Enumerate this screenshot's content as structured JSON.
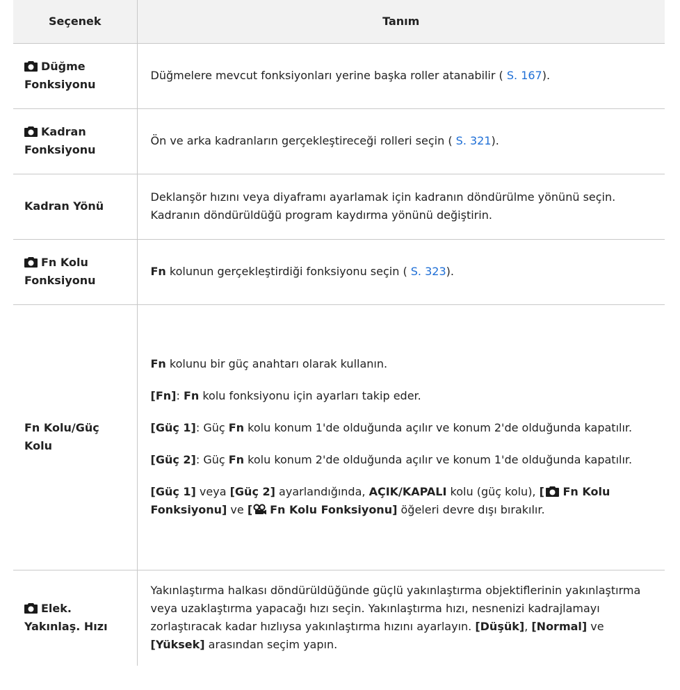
{
  "header": {
    "col1": "Seçenek",
    "col2": "Tanım"
  },
  "rows": {
    "r1": {
      "opt_line1": "Düğme",
      "opt_line2": "Fonksiyonu",
      "desc_pre": "Düğmelere mevcut fonksiyonları yerine başka roller atanabilir ( ",
      "desc_link": "S. 167",
      "desc_post": ")."
    },
    "r2": {
      "opt_line1": "Kadran",
      "opt_line2": "Fonksiyonu",
      "desc_pre": "Ön ve arka kadranların gerçekleştireceği rolleri seçin ( ",
      "desc_link": "S. 321",
      "desc_post": ")."
    },
    "r3": {
      "opt": "Kadran Yönü",
      "desc": "Deklanşör hızını veya diyaframı ayarlamak için kadranın döndürülme yönünü seçin. Kadranın döndürüldüğü program kaydırma yönünü değiştirin."
    },
    "r4": {
      "opt_line1": "Fn Kolu",
      "opt_line2": "Fonksiyonu",
      "desc_bold": "Fn",
      "desc_pre": " kolunun gerçekleştirdiği fonksiyonu seçin ( ",
      "desc_link": "S. 323",
      "desc_post": ")."
    },
    "r5": {
      "opt_line1": "Fn Kolu/Güç",
      "opt_line2": "Kolu",
      "p1_bold": "Fn",
      "p1_text": " kolunu bir güç anahtarı olarak kullanın.",
      "p2_bold1": "[Fn]",
      "p2_text1": ": ",
      "p2_bold2": "Fn",
      "p2_text2": " kolu fonksiyonu için ayarları takip eder.",
      "p3_bold1": "[Güç 1]",
      "p3_text1": ": Güç ",
      "p3_bold2": "Fn",
      "p3_text2": " kolu konum 1'de olduğunda açılır ve konum 2'de olduğunda kapatılır.",
      "p4_bold1": "[Güç 2]",
      "p4_text1": ": Güç ",
      "p4_bold2": "Fn",
      "p4_text2": " kolu konum 2'de olduğunda açılır ve konum 1'de olduğunda kapatılır.",
      "p5_bold1": "[Güç 1]",
      "p5_text1": " veya ",
      "p5_bold2": "[Güç 2]",
      "p5_text2": " ayarlandığında, ",
      "p5_bold3": "AÇIK/KAPALI",
      "p5_text3": " kolu (güç kolu), ",
      "p5_bold4a": "[",
      "p5_bold4b": " Fn Kolu Fonksiyonu]",
      "p5_text4": " ve ",
      "p5_bold5a": "[",
      "p5_bold5b": "Fn Kolu Fonksiyonu]",
      "p5_text5": " öğeleri devre dışı bırakılır."
    },
    "r6": {
      "opt_line1": "Elek.",
      "opt_line2": "Yakınlaş. Hızı",
      "desc_text1": "Yakınlaştırma halkası döndürüldüğünde güçlü yakınlaştırma objektiflerinin yakınlaştırma veya uzaklaştırma yapacağı hızı seçin. Yakınlaştırma hızı, nesnenizi kadrajlamayı zorlaştıracak kadar hızlıysa yakınlaştırma hızını ayarlayın. ",
      "desc_bold1": "[Düşük]",
      "desc_text2": ", ",
      "desc_bold2": "[Normal]",
      "desc_text3": " ve ",
      "desc_bold3": "[Yüksek]",
      "desc_text4": " arasından seçim yapın."
    }
  },
  "icons": {
    "camera": "camera-icon",
    "movie": "movie-camera-icon"
  },
  "colors": {
    "link": "#1f6fd6",
    "header_bg": "#f2f2f2",
    "border": "#c8c8c8"
  }
}
